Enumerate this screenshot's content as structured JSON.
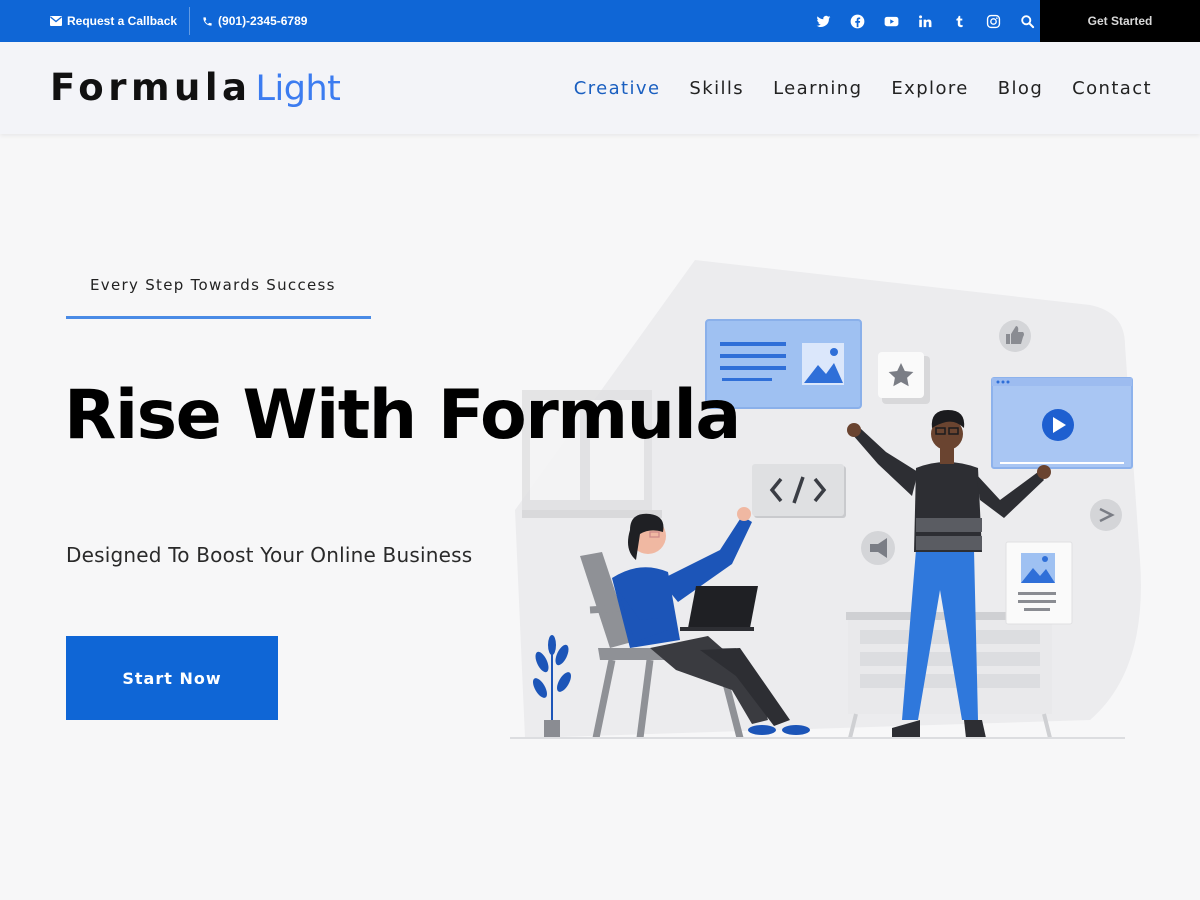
{
  "topbar": {
    "callback_label": "Request a Callback",
    "phone": "(901)-2345-6789",
    "get_started_label": "Get Started",
    "social_icons": [
      "twitter-icon",
      "facebook-icon",
      "youtube-icon",
      "linkedin-icon",
      "tumblr-icon",
      "instagram-icon",
      "search-icon"
    ],
    "bg_color": "#0f66d6"
  },
  "header": {
    "logo_main": "Formula",
    "logo_accent": "Light",
    "nav": [
      {
        "label": "Creative",
        "active": true
      },
      {
        "label": "Skills",
        "active": false
      },
      {
        "label": "Learning",
        "active": false
      },
      {
        "label": "Explore",
        "active": false
      },
      {
        "label": "Blog",
        "active": false
      },
      {
        "label": "Contact",
        "active": false
      }
    ]
  },
  "hero": {
    "tagline": "Every Step Towards Success",
    "headline": "Rise With Formula",
    "subheadline": "Designed To Boost Your Online Business",
    "cta_label": "Start Now",
    "accent_color": "#0f66d6"
  }
}
